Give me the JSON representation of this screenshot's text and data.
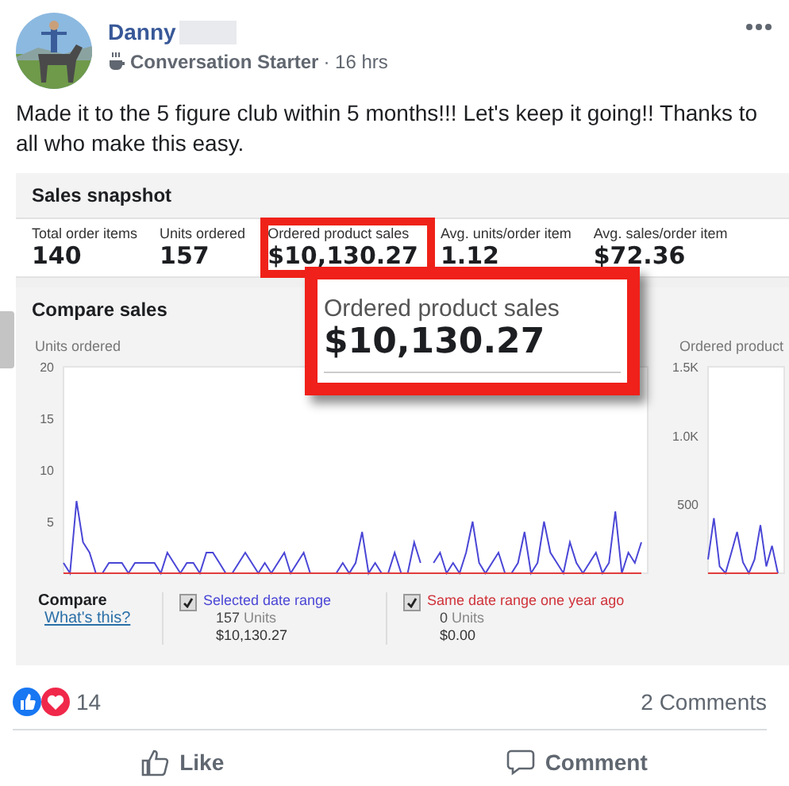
{
  "post": {
    "author": "Danny",
    "badge": "Conversation Starter",
    "time": "· 16 hrs",
    "text": "Made it to the 5 figure club within 5 months!!! Let's keep it going!! Thanks to all who make this easy."
  },
  "snapshot": {
    "title": "Sales snapshot",
    "metrics": [
      {
        "label": "Total order items",
        "value": "140",
        "highlighted": false
      },
      {
        "label": "Units ordered",
        "value": "157",
        "highlighted": false
      },
      {
        "label": "Ordered product sales",
        "value": "$10,130.27",
        "highlighted": true
      },
      {
        "label": "Avg. units/order item",
        "value": "1.12",
        "highlighted": false
      },
      {
        "label": "Avg. sales/order item",
        "value": "$72.36",
        "highlighted": false
      }
    ]
  },
  "callout": {
    "label": "Ordered product sales",
    "value": "$10,130.27"
  },
  "compare_sales": {
    "title": "Compare sales",
    "charts": [
      {
        "chart_data": {
          "type": "line",
          "ylabel": "Units ordered",
          "ylim": [
            0,
            20
          ],
          "yticks": [
            5,
            10,
            15,
            20
          ],
          "series": [
            {
              "color": "#4a46d6",
              "values": [
                1,
                0,
                7,
                3,
                2,
                0,
                0,
                1,
                1,
                1,
                0,
                1,
                1,
                1,
                1,
                0,
                2,
                1,
                0,
                1,
                1,
                0,
                2,
                2,
                1,
                0,
                0,
                1,
                2,
                1,
                0,
                1,
                0,
                1,
                2,
                0,
                1,
                2,
                0,
                0,
                0,
                0,
                0,
                1,
                0,
                1,
                4,
                0,
                1,
                0,
                0,
                2,
                0,
                0,
                3,
                1,
                null,
                1,
                2,
                0,
                1,
                0,
                2,
                5,
                1,
                0,
                1,
                2,
                0,
                0,
                1,
                4,
                0,
                1,
                5,
                2,
                1,
                0,
                3,
                1,
                0,
                1,
                2,
                0,
                1,
                6,
                0,
                2,
                1,
                3
              ]
            },
            {
              "color": "#e03c3c",
              "values": [
                0,
                0,
                0,
                0,
                0,
                0,
                0,
                0,
                0,
                0,
                0,
                0,
                0,
                0,
                0,
                0,
                0,
                0,
                0,
                0,
                0,
                0,
                0,
                0,
                0,
                0,
                0,
                0,
                0,
                0,
                0,
                0,
                0,
                0,
                0,
                0,
                0,
                0,
                0,
                0,
                0,
                0,
                0,
                0,
                0,
                0,
                0,
                0,
                0,
                0,
                0,
                0,
                0,
                0,
                0,
                0,
                0,
                0,
                0,
                0,
                0,
                0,
                0,
                0,
                0,
                0,
                0,
                0,
                0,
                0,
                0,
                0,
                0,
                0,
                0,
                0,
                0,
                0,
                0,
                0,
                0,
                0,
                0,
                0,
                0,
                0,
                0,
                0,
                0,
                0
              ]
            }
          ]
        }
      },
      {
        "chart_data": {
          "type": "line",
          "ylabel": "Ordered product",
          "ylim": [
            0,
            1500
          ],
          "yticks": [
            500,
            {
              "value": 1000,
              "label": "1.0K"
            },
            {
              "value": 1500,
              "label": "1.5K"
            }
          ],
          "series": [
            {
              "color": "#4a46d6",
              "values": [
                100,
                400,
                50,
                0,
                150,
                300,
                80,
                0,
                100,
                350,
                50,
                200,
                0
              ]
            },
            {
              "color": "#e03c3c",
              "values": [
                0,
                0,
                0,
                0,
                0,
                0,
                0,
                0,
                0,
                0,
                0,
                0,
                0
              ]
            }
          ]
        }
      }
    ],
    "compare": {
      "title": "Compare",
      "link": "What's this?",
      "ranges": [
        {
          "label": "Selected date range",
          "color": "#4a46d6",
          "checked": true,
          "units": "157",
          "unit_label": "Units",
          "sales": "$10,130.27"
        },
        {
          "label": "Same date range one year ago",
          "color": "#d0323a",
          "checked": true,
          "units": "0",
          "unit_label": "Units",
          "sales": "$0.00"
        }
      ]
    }
  },
  "reactions": {
    "count": "14",
    "comments": "2 Comments"
  },
  "actions": [
    {
      "kind": "like",
      "label": "Like"
    },
    {
      "kind": "comment",
      "label": "Comment"
    }
  ]
}
